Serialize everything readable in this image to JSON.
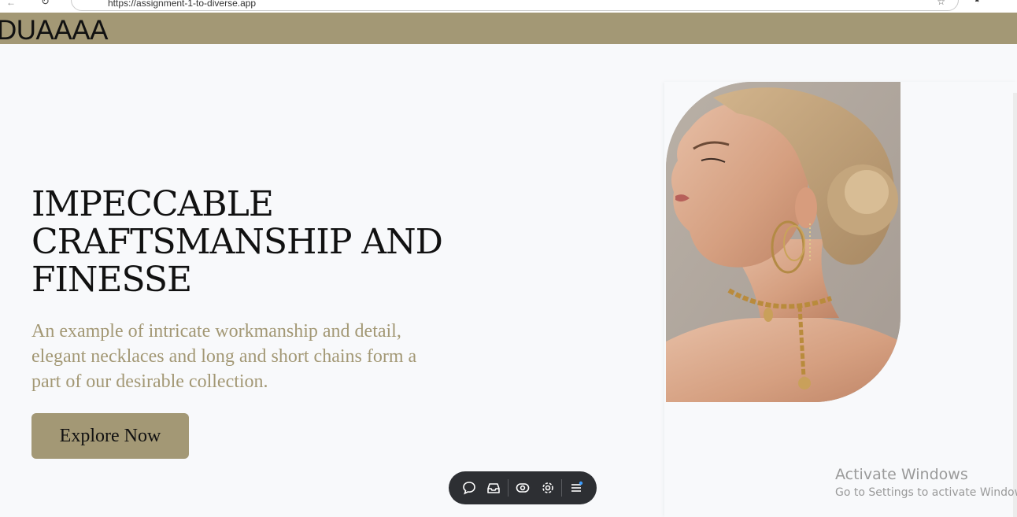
{
  "browser": {
    "url": "https://assignment-1-to-diverse.app",
    "icons": [
      "back-icon",
      "reload-icon",
      "page-info-icon",
      "bookmark-star-icon",
      "extension-icon"
    ]
  },
  "header": {
    "logo": "DUAAAA",
    "background_color": "#a39875"
  },
  "hero": {
    "title": "IMPECCABLE CRAFTSMANSHIP AND FINESSE",
    "description": "An example of intricate workmanship and detail, elegant necklaces and long and short chains form a part of our desirable collection.",
    "cta_label": "Explore Now",
    "accent_color": "#a39875",
    "image_subject": "woman-with-gold-jewelry-photo"
  },
  "toolbar": {
    "icons": [
      "comment-icon",
      "inbox-icon",
      "eye-icon",
      "settings-gear-icon",
      "menu-icon"
    ]
  },
  "watermark": {
    "title": "Activate Windows",
    "subtitle": "Go to Settings to activate Windows."
  }
}
